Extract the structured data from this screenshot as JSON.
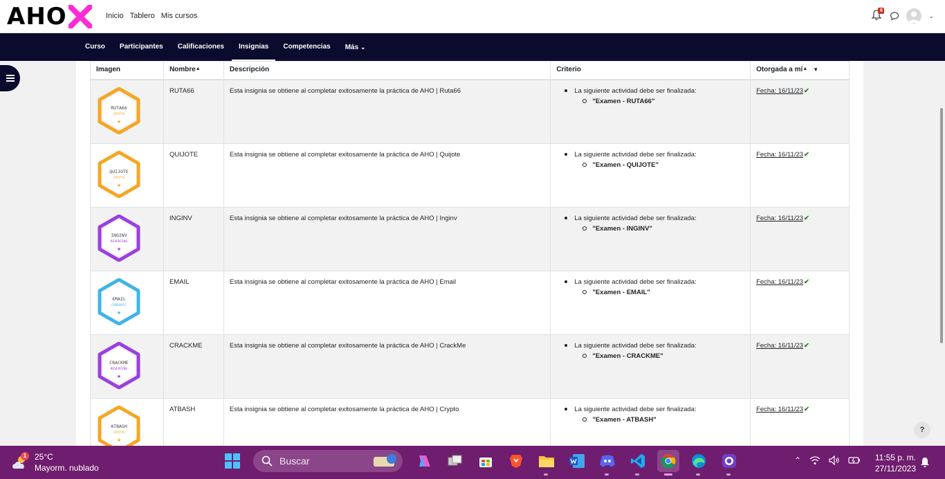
{
  "brand": {
    "logo_text": "AHO"
  },
  "topnav": {
    "items": [
      "Inicio",
      "Tablero",
      "Mis cursos"
    ]
  },
  "notifications": {
    "count": "6"
  },
  "course_nav": {
    "items": [
      "Curso",
      "Participantes",
      "Calificaciones",
      "Insignias",
      "Competencias",
      "Más"
    ],
    "active": "Insignias"
  },
  "table": {
    "headers": {
      "image": "Imagen",
      "name": "Nombre",
      "description": "Descripción",
      "criteria": "Criterio",
      "awarded": "Otorgada a mí"
    },
    "rows": [
      {
        "badge_text": "RUTA66",
        "badge_subtitle": "CRYPTO",
        "badge_color": "#f5a623",
        "name": "RUTA66",
        "description": "Esta insignia se obtiene al completar exitosamente la práctica de AHO | Ruta66",
        "criteria_intro": "La siguiente actividad debe ser finalizada:",
        "criteria_item": "\"Examen - RUTA66\"",
        "date": "Fecha: 16/11/23"
      },
      {
        "badge_text": "QUIJOTE",
        "badge_subtitle": "CRYPTO",
        "badge_color": "#f5a623",
        "name": "QUIJOTE",
        "description": "Esta insignia se obtiene al completar exitosamente la práctica de AHO | Quijote",
        "criteria_intro": "La siguiente actividad debe ser finalizada:",
        "criteria_item": "\"Examen - QUIJOTE\"",
        "date": "Fecha: 16/11/23"
      },
      {
        "badge_text": "INGINV",
        "badge_subtitle": "REVERSING",
        "badge_color": "#9b3fe0",
        "name": "INGINV",
        "description": "Esta insignia se obtiene al completar exitosamente la práctica de AHO | Inginv",
        "criteria_intro": "La siguiente actividad debe ser finalizada:",
        "criteria_item": "\"Examen - INGINV\"",
        "date": "Fecha: 16/11/23"
      },
      {
        "badge_text": "EMAIL",
        "badge_subtitle": "FORENSIC",
        "badge_color": "#3fb4ea",
        "name": "EMAIL",
        "description": "Esta insignia se obtiene al completar exitosamente la práctica de AHO | Email",
        "criteria_intro": "La siguiente actividad debe ser finalizada:",
        "criteria_item": "\"Examen - EMAIL\"",
        "date": "Fecha: 16/11/23"
      },
      {
        "badge_text": "CRACKME",
        "badge_subtitle": "REVERSING",
        "badge_color": "#9b3fe0",
        "name": "CRACKME",
        "description": "Esta insignia se obtiene al completar exitosamente la práctica de AHO | CrackMe",
        "criteria_intro": "La siguiente actividad debe ser finalizada:",
        "criteria_item": "\"Examen - CRACKME\"",
        "date": "Fecha: 16/11/23"
      },
      {
        "badge_text": "ATBASH",
        "badge_subtitle": "CRYPTO",
        "badge_color": "#f5a623",
        "name": "ATBASH",
        "description": "Esta insignia se obtiene al completar exitosamente la práctica de AHO | Crypto",
        "criteria_intro": "La siguiente actividad debe ser finalizada:",
        "criteria_item": "\"Examen - ATBASH\"",
        "date": "Fecha: 16/11/23"
      }
    ]
  },
  "help": {
    "label": "?"
  },
  "taskbar": {
    "weather_temp": "25°C",
    "weather_desc": "Mayorm. nublado",
    "weather_badge": "1",
    "search_placeholder": "Buscar",
    "time": "11:55 p. m.",
    "date": "27/11/2023"
  },
  "colors": {
    "navbar": "#0b0b2e",
    "taskbar": "#6f1d6e",
    "logo_accent": "#ff2bd6"
  }
}
